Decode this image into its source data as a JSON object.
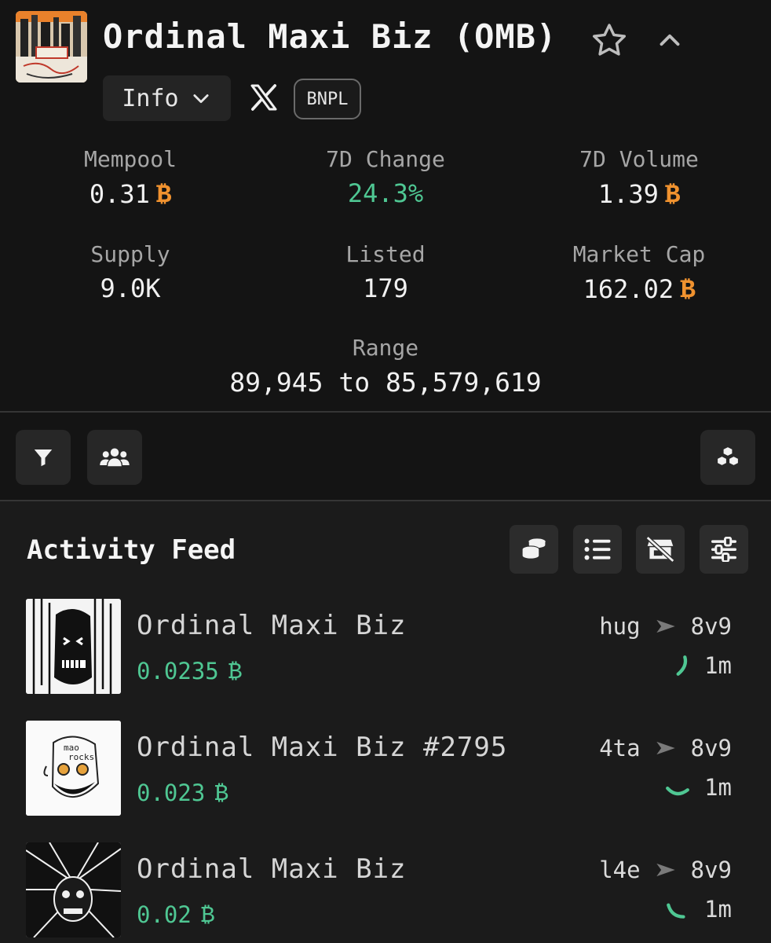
{
  "collection": {
    "title": "Ordinal Maxi Biz (OMB)",
    "info_label": "Info",
    "badge": "BNPL"
  },
  "stats": [
    {
      "label": "Mempool",
      "value": "0.31",
      "unit": "₿"
    },
    {
      "label": "7D Change",
      "value": "24.3%",
      "unit": ""
    },
    {
      "label": "7D Volume",
      "value": "1.39",
      "unit": "₿"
    },
    {
      "label": "Supply",
      "value": "9.0K",
      "unit": ""
    },
    {
      "label": "Listed",
      "value": "179",
      "unit": ""
    },
    {
      "label": "Market Cap",
      "value": "162.02",
      "unit": "₿"
    }
  ],
  "range": {
    "label": "Range",
    "value": "89,945 to 85,579,619"
  },
  "toolbar": {
    "icons": [
      "filter-icon",
      "users-icon",
      "cubes-icon"
    ]
  },
  "feed": {
    "title": "Activity Feed",
    "icons": [
      "coins-icon",
      "list-icon",
      "no-store-icon",
      "sliders-icon"
    ],
    "rows": [
      {
        "name": "Ordinal Maxi Biz",
        "price": "0.0235",
        "unit": "₿",
        "from": "hug",
        "to": "8v9",
        "time": "1m"
      },
      {
        "name": "Ordinal Maxi Biz #2795",
        "price": "0.023",
        "unit": "₿",
        "from": "4ta",
        "to": "8v9",
        "time": "1m"
      },
      {
        "name": "Ordinal Maxi Biz",
        "price": "0.02",
        "unit": "₿",
        "from": "l4e",
        "to": "8v9",
        "time": "1m"
      }
    ]
  },
  "colors": {
    "accent_green": "#4fc793",
    "bitcoin_orange": "#f0922f",
    "background": "#141414"
  }
}
